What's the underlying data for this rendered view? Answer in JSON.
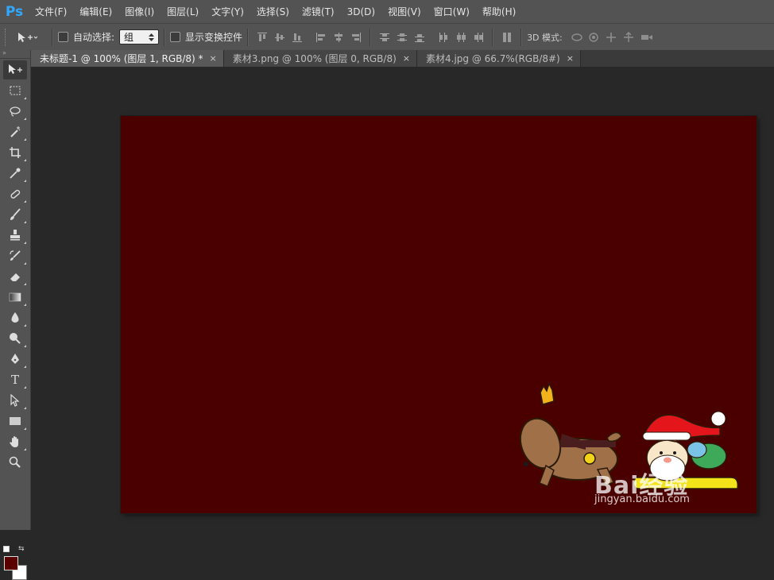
{
  "app": {
    "logo": "Ps"
  },
  "menu": [
    "文件(F)",
    "编辑(E)",
    "图像(I)",
    "图层(L)",
    "文字(Y)",
    "选择(S)",
    "滤镜(T)",
    "3D(D)",
    "视图(V)",
    "窗口(W)",
    "帮助(H)"
  ],
  "options": {
    "auto_select_label": "自动选择:",
    "auto_select_value": "组",
    "show_transform_label": "显示变换控件",
    "mode_3d_label": "3D 模式:"
  },
  "tabs": [
    {
      "label": "未标题-1 @ 100% (图层 1, RGB/8) *",
      "active": true
    },
    {
      "label": "素材3.png @ 100% (图层 0, RGB/8)",
      "active": false
    },
    {
      "label": "素材4.jpg @ 66.7%(RGB/8#)",
      "active": false
    }
  ],
  "colors": {
    "foreground": "#5a0000",
    "background": "#ffffff",
    "document": "#4b0000"
  },
  "watermark": {
    "brand": "Bai经验",
    "url": "jingyan.baidu.com"
  }
}
